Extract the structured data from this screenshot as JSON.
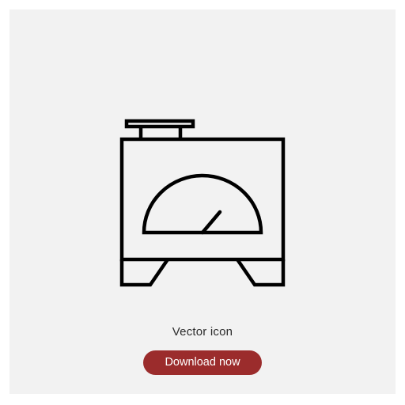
{
  "icon": {
    "name": "meter-gauge-icon",
    "stroke_color": "#000000"
  },
  "caption": "Vector icon",
  "download_button": {
    "label": "Download now",
    "color": "#9b2c2c"
  },
  "background_color": "#f2f2f2"
}
